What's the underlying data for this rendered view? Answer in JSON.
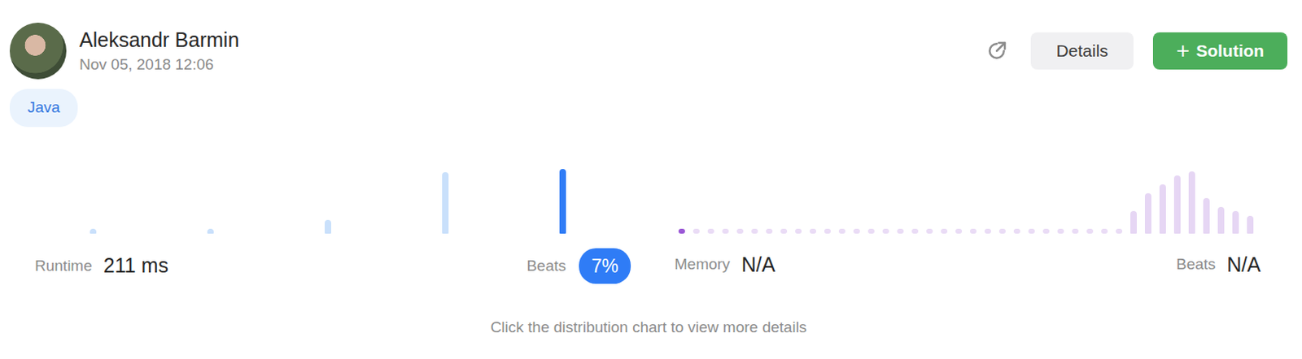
{
  "user": {
    "name": "Aleksandr Barmin",
    "date": "Nov 05, 2018 12:06"
  },
  "actions": {
    "details": "Details",
    "solution_icon": "+",
    "solution": "Solution"
  },
  "language": "Java",
  "runtime": {
    "label": "Runtime",
    "value": "211 ms",
    "beats_label": "Beats",
    "beats": "7%",
    "bars": [
      {
        "value": 1,
        "selected": false
      },
      {
        "value": 1,
        "selected": false
      },
      {
        "value": 4,
        "selected": false
      },
      {
        "value": 18,
        "selected": false
      },
      {
        "value": 19,
        "selected": true
      }
    ]
  },
  "memory": {
    "label": "Memory",
    "value": "N/A",
    "beats_label": "Beats",
    "beats": "N/A",
    "bars": [
      {
        "value": 0,
        "selected": true
      },
      {
        "value": 0,
        "selected": false
      },
      {
        "value": 0,
        "selected": false
      },
      {
        "value": 0,
        "selected": false
      },
      {
        "value": 0,
        "selected": false
      },
      {
        "value": 0,
        "selected": false
      },
      {
        "value": 0,
        "selected": false
      },
      {
        "value": 0,
        "selected": false
      },
      {
        "value": 0,
        "selected": false
      },
      {
        "value": 0,
        "selected": false
      },
      {
        "value": 0,
        "selected": false
      },
      {
        "value": 0,
        "selected": false
      },
      {
        "value": 0,
        "selected": false
      },
      {
        "value": 0,
        "selected": false
      },
      {
        "value": 0,
        "selected": false
      },
      {
        "value": 0,
        "selected": false
      },
      {
        "value": 0,
        "selected": false
      },
      {
        "value": 0,
        "selected": false
      },
      {
        "value": 0,
        "selected": false
      },
      {
        "value": 0,
        "selected": false
      },
      {
        "value": 0,
        "selected": false
      },
      {
        "value": 0,
        "selected": false
      },
      {
        "value": 0,
        "selected": false
      },
      {
        "value": 0,
        "selected": false
      },
      {
        "value": 0,
        "selected": false
      },
      {
        "value": 0,
        "selected": false
      },
      {
        "value": 0,
        "selected": false
      },
      {
        "value": 0,
        "selected": false
      },
      {
        "value": 0,
        "selected": false
      },
      {
        "value": 0,
        "selected": false
      },
      {
        "value": 0,
        "selected": false
      },
      {
        "value": 5,
        "selected": false
      },
      {
        "value": 9,
        "selected": false
      },
      {
        "value": 11,
        "selected": false
      },
      {
        "value": 13,
        "selected": false
      },
      {
        "value": 14,
        "selected": false
      },
      {
        "value": 8,
        "selected": false
      },
      {
        "value": 6,
        "selected": false
      },
      {
        "value": 5,
        "selected": false
      },
      {
        "value": 4,
        "selected": false
      }
    ]
  },
  "hint": "Click the distribution chart to view more details"
}
